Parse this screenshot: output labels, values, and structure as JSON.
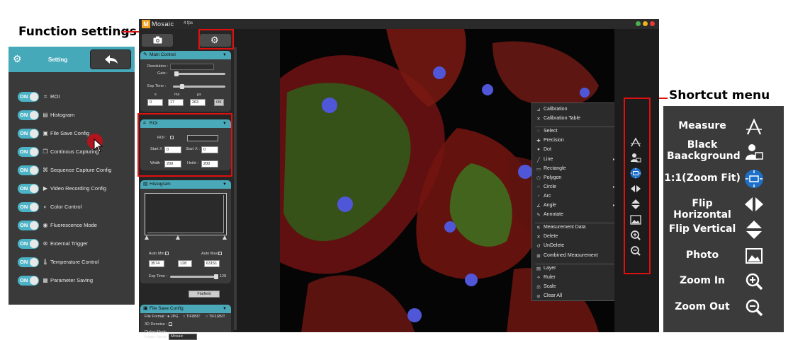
{
  "callouts": {
    "function_settings": "Function settings",
    "shortcut_menu": "Shortcut menu"
  },
  "colors": {
    "accent": "#4aa9b8",
    "highlight": "#e01010",
    "panel": "#3a3a3a"
  },
  "settings": {
    "title": "Setting",
    "items": [
      {
        "toggle": "ON",
        "icon": "roi-icon",
        "label": "ROI"
      },
      {
        "toggle": "ON",
        "icon": "histogram-icon",
        "label": "Histogram"
      },
      {
        "toggle": "ON",
        "icon": "file-save-icon",
        "label": "File Save Config"
      },
      {
        "toggle": "ON",
        "icon": "continuous-icon",
        "label": "Continous Capturing"
      },
      {
        "toggle": "ON",
        "icon": "sequence-icon",
        "label": "Sequence Capture Config"
      },
      {
        "toggle": "ON",
        "icon": "video-icon",
        "label": "Video Recording Config"
      },
      {
        "toggle": "ON",
        "icon": "color-icon",
        "label": "Color Control"
      },
      {
        "toggle": "ON",
        "icon": "fluorescence-icon",
        "label": "Fluorescence Mode"
      },
      {
        "toggle": "ON",
        "icon": "trigger-icon",
        "label": "External Trigger"
      },
      {
        "toggle": "ON",
        "icon": "temperature-icon",
        "label": "Temperature Control"
      },
      {
        "toggle": "ON",
        "icon": "save-icon",
        "label": "Parameter Saving"
      }
    ]
  },
  "app": {
    "name": "Mosaic",
    "logo_letter": "M",
    "fps": "4 fps",
    "main_control": {
      "title": "Main Control",
      "resolution": "Resolution :",
      "gain": "Gain :",
      "exp_time": "Exp Time :",
      "units": [
        "s",
        "ms",
        "μs"
      ],
      "values": [
        "0",
        "17",
        "263"
      ],
      "ok": "OK"
    },
    "roi": {
      "title": "ROI",
      "roi": "ROI :",
      "start_x1": "Start X :",
      "start_x1_value": "0",
      "start_x2": "Start X :",
      "start_x2_value": "0",
      "width": "Width :",
      "width_value": "200",
      "height": "Heiht :",
      "height_value": "200"
    },
    "histogram": {
      "title": "Histogram",
      "auto_min": "Auto Min :",
      "auto_max": "Auto Max :",
      "values": [
        "3574",
        "128",
        "63151"
      ],
      "exp_time": "Exp Time :",
      "exp_value": "128",
      "flatfield": "Flatfield"
    },
    "file_save": {
      "title": "File Save Config",
      "file_format": "File Format :",
      "formats": [
        "JPG",
        "TIF8BIT",
        "TIF16BIT"
      ],
      "denoise": "3D Denoise :",
      "dialog_mode": "Dialog Mode :",
      "image_name": "Image Name :",
      "image_name_value": "Mosaic"
    },
    "context_menu": [
      {
        "label": "Calibration",
        "icon": "calibration-icon"
      },
      {
        "label": "Calibration Table",
        "icon": "table-icon"
      },
      {
        "sep": true
      },
      {
        "label": "Select",
        "icon": "select-icon"
      },
      {
        "label": "Precision",
        "icon": "precision-icon"
      },
      {
        "label": "Dot",
        "icon": "dot-icon"
      },
      {
        "label": "Line",
        "icon": "line-icon",
        "sub": true
      },
      {
        "label": "Rectangle",
        "icon": "rectangle-icon"
      },
      {
        "label": "Polygon",
        "icon": "polygon-icon"
      },
      {
        "label": "Circle",
        "icon": "circle-icon",
        "sub": true
      },
      {
        "label": "Arc",
        "icon": "arc-icon"
      },
      {
        "label": "Angle",
        "icon": "angle-icon",
        "sub": true
      },
      {
        "label": "Annotate",
        "icon": "annotate-icon"
      },
      {
        "sep": true
      },
      {
        "label": "Measurement Data",
        "icon": "measure-data-icon"
      },
      {
        "label": "Delete",
        "icon": "delete-icon"
      },
      {
        "label": "UnDelete",
        "icon": "undelete-icon"
      },
      {
        "label": "Combined Measurement",
        "icon": "combined-icon"
      },
      {
        "sep": true
      },
      {
        "label": "Layer",
        "icon": "layer-icon"
      },
      {
        "label": "Ruler",
        "icon": "ruler-icon"
      },
      {
        "label": "Scale",
        "icon": "scale-icon"
      },
      {
        "label": "Clear All",
        "icon": "clear-icon"
      }
    ]
  },
  "shortcuts": [
    {
      "label": "Measure",
      "icon": "measure-icon"
    },
    {
      "label": "Black Baackground",
      "icon": "black-background-icon"
    },
    {
      "label": "1:1(Zoom Fit)",
      "icon": "zoom-fit-icon"
    },
    {
      "label": "Flip Horizontal",
      "icon": "flip-horizontal-icon"
    },
    {
      "label": "Flip Vertical",
      "icon": "flip-vertical-icon"
    },
    {
      "label": "Photo",
      "icon": "photo-icon"
    },
    {
      "label": "Zoom In",
      "icon": "zoom-in-icon"
    },
    {
      "label": "Zoom Out",
      "icon": "zoom-out-icon"
    }
  ]
}
